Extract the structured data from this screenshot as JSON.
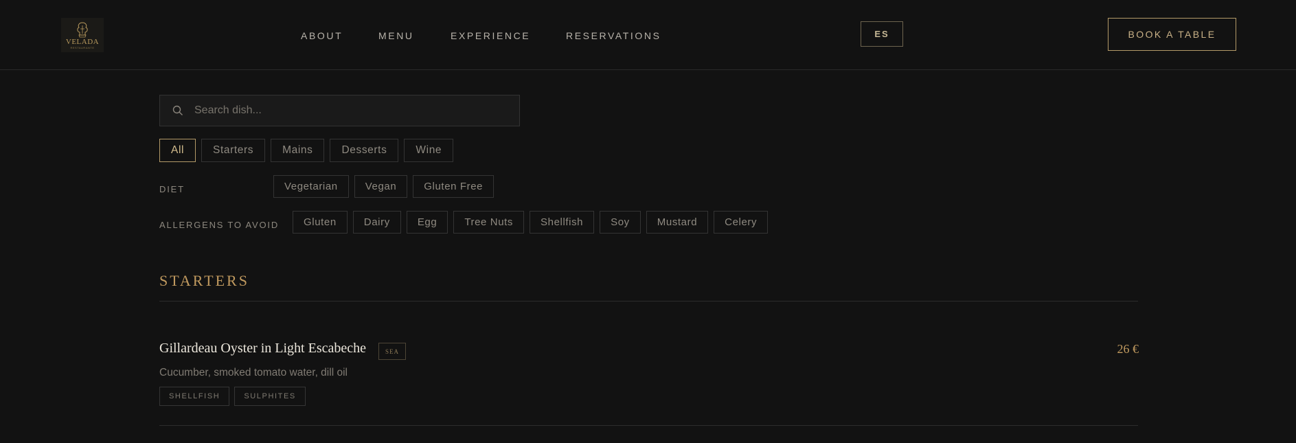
{
  "header": {
    "logo_text": "VELADA",
    "logo_subtext": "RESTAURANTE",
    "nav": [
      "ABOUT",
      "MENU",
      "EXPERIENCE",
      "RESERVATIONS"
    ],
    "language_button": "ES",
    "book_button": "BOOK A TABLE"
  },
  "search": {
    "placeholder": "Search dish...",
    "value": ""
  },
  "categories": {
    "items": [
      "All",
      "Starters",
      "Mains",
      "Desserts",
      "Wine"
    ],
    "selected": "All"
  },
  "diet": {
    "label": "DIET",
    "items": [
      "Vegetarian",
      "Vegan",
      "Gluten Free"
    ]
  },
  "allergens": {
    "label": "ALLERGENS TO AVOID",
    "items": [
      "Gluten",
      "Dairy",
      "Egg",
      "Tree Nuts",
      "Shellfish",
      "Soy",
      "Mustard",
      "Celery"
    ]
  },
  "section": {
    "title": "STARTERS",
    "dishes": [
      {
        "name": "Gillardeau Oyster in Light Escabeche",
        "tag": "SEA",
        "price": "26 €",
        "description": "Cucumber, smoked tomato water, dill oil",
        "allergens": [
          "SHELLFISH",
          "SULPHITES"
        ]
      }
    ]
  },
  "colors": {
    "background": "#121212",
    "accent_gold": "#c19a5f",
    "border": "#343434"
  }
}
